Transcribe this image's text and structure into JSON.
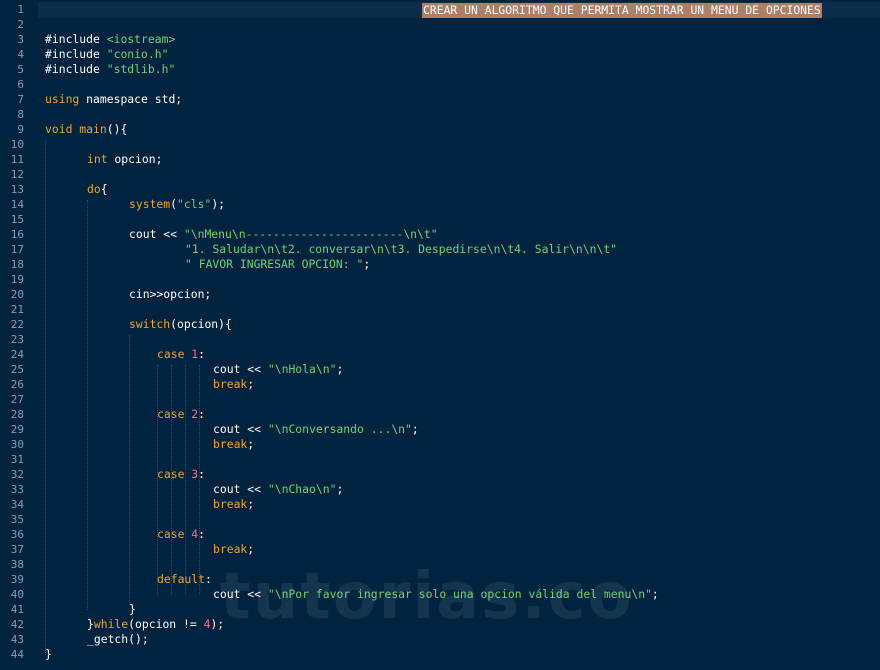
{
  "selection_text": "CREAR UN ALGORITMO QUE PERMITA MOSTRAR UN MENU DE OPCIONES",
  "watermark": "tutorias.co",
  "line_numbers": [
    "1",
    "2",
    "3",
    "4",
    "5",
    "6",
    "7",
    "8",
    "9",
    "10",
    "11",
    "12",
    "13",
    "14",
    "15",
    "16",
    "17",
    "18",
    "19",
    "20",
    "21",
    "22",
    "23",
    "24",
    "25",
    "26",
    "27",
    "28",
    "29",
    "30",
    "31",
    "32",
    "33",
    "34",
    "35",
    "36",
    "37",
    "38",
    "39",
    "40",
    "41",
    "42",
    "43",
    "44"
  ],
  "code": {
    "l3_pre": "#include ",
    "l3_inc": "<iostream>",
    "l4_pre": "#include ",
    "l4_inc": "\"conio.h\"",
    "l5_pre": "#include ",
    "l5_inc": "\"stdlib.h\"",
    "l7_kw": "using",
    "l7_rest": " namespace std;",
    "l9_kw": "void",
    "l9_name": " main",
    "l9_rest": "(){",
    "l11_kw": "int",
    "l11_rest": " opcion;",
    "l13_kw": "do",
    "l13_rest": "{",
    "l14_fn": "system",
    "l14_p1": "(",
    "l14_str": "\"cls\"",
    "l14_p2": ");",
    "l16_a": "cout << ",
    "l16_str": "\"\\nMenu\\n-----------------------\\n\\t\"",
    "l17_str": "\"1. Saludar\\n\\t2. conversar\\n\\t3. Despedirse\\n\\t4. Salir\\n\\n\\t\"",
    "l18_str": "\" FAVOR INGRESAR OPCION: \"",
    "l18_rest": ";",
    "l20": "cin>>opcion;",
    "l22_kw": "switch",
    "l22_rest": "(opcion){",
    "case_kw": "case",
    "c1": " 1",
    "c2": " 2",
    "c3": " 3",
    "c4": " 4",
    "colon": ":",
    "cout": "cout << ",
    "s25": "\"\\nHola\\n\"",
    "s29": "\"\\nConversando ...\\n\"",
    "s33": "\"\\nChao\\n\"",
    "s40": "\"\\nPor favor ingresar solo una opcion válida del menu\\n\"",
    "semi": ";",
    "break_kw": "break",
    "default_kw": "default",
    "l41": "}",
    "l42_a": "}",
    "l42_kw": "while",
    "l42_b": "(opcion != ",
    "l42_num": "4",
    "l42_c": ");",
    "l43": "_getch();",
    "l44": "}"
  },
  "colors": {
    "background": "#00233f",
    "keyword": "#f0a52c",
    "string": "#6fd36f",
    "number": "#ff6b8a",
    "selection": "#b07d67"
  }
}
